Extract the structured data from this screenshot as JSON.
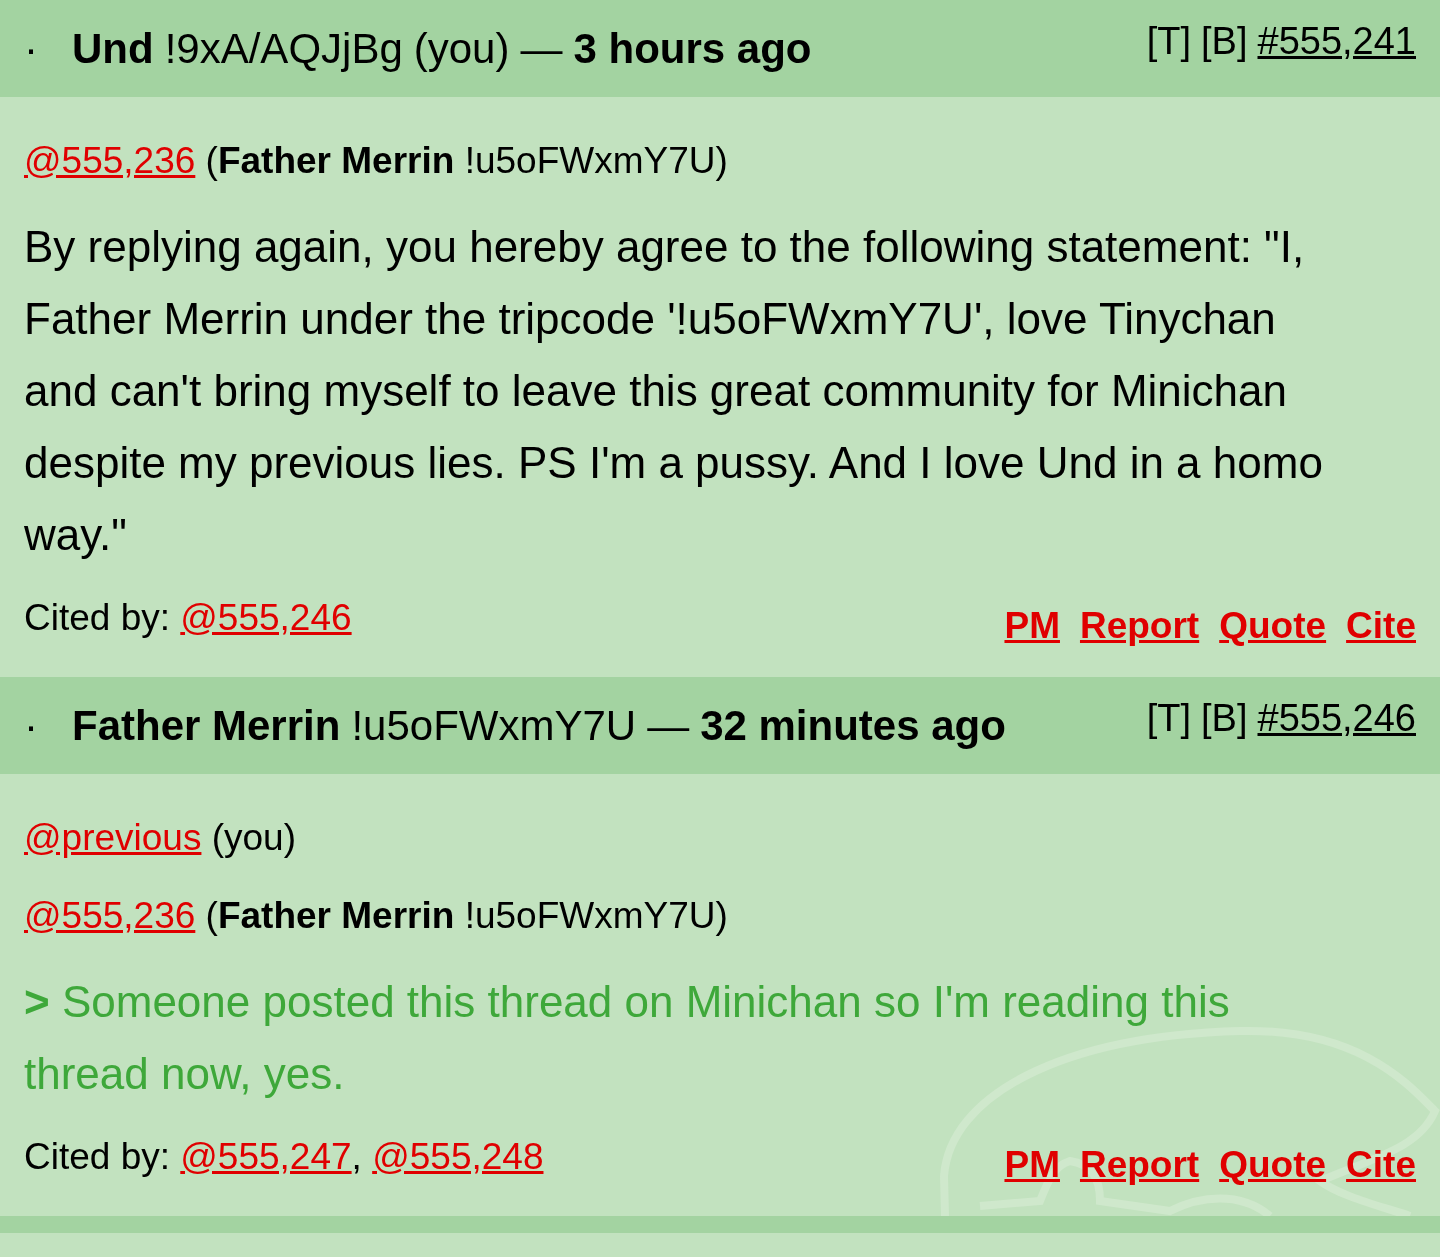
{
  "posts": [
    {
      "bullet": "·",
      "author": "Und",
      "tripcode": "!9xA/AQJjBg",
      "you_label": "(you)",
      "dash": "—",
      "time": "3 hours ago",
      "tools": [
        "[T]",
        "[B]"
      ],
      "number": "#555,241",
      "body": [
        {
          "kind": "cite",
          "link": "@555,236",
          "detail": "(**Father Merrin** !u5oFWxmY7U)"
        },
        {
          "kind": "text",
          "text": "By replying again, you hereby agree to the following statement: \"I, Father Merrin under the tripcode '!u5oFWxmY7U', love Tinychan and can't bring myself to leave this great community for Minichan despite my previous lies. PS I'm a pussy. And I love Und in a homo way.\""
        }
      ],
      "cited_by_label": "Cited by:",
      "cited_by": [
        "@555,246"
      ],
      "actions": [
        "PM",
        "Report",
        "Quote",
        "Cite"
      ]
    },
    {
      "bullet": "·",
      "author": "Father Merrin",
      "tripcode": "!u5oFWxmY7U",
      "dash": "—",
      "time": "32 minutes ago",
      "tools": [
        "[T]",
        "[B]"
      ],
      "number": "#555,246",
      "body": [
        {
          "kind": "cite-you",
          "link": "@previous",
          "note": "(you)"
        },
        {
          "kind": "cite",
          "link": "@555,236",
          "detail": "(**Father Merrin** !u5oFWxmY7U)"
        },
        {
          "kind": "quote",
          "text": "**>** Someone posted this thread on Minichan so I'm reading this thread now, yes."
        }
      ],
      "cited_by_label": "Cited by:",
      "cited_by": [
        "@555,247",
        "@555,248"
      ],
      "separator": ",",
      "actions": [
        "PM",
        "Report",
        "Quote",
        "Cite"
      ]
    }
  ]
}
